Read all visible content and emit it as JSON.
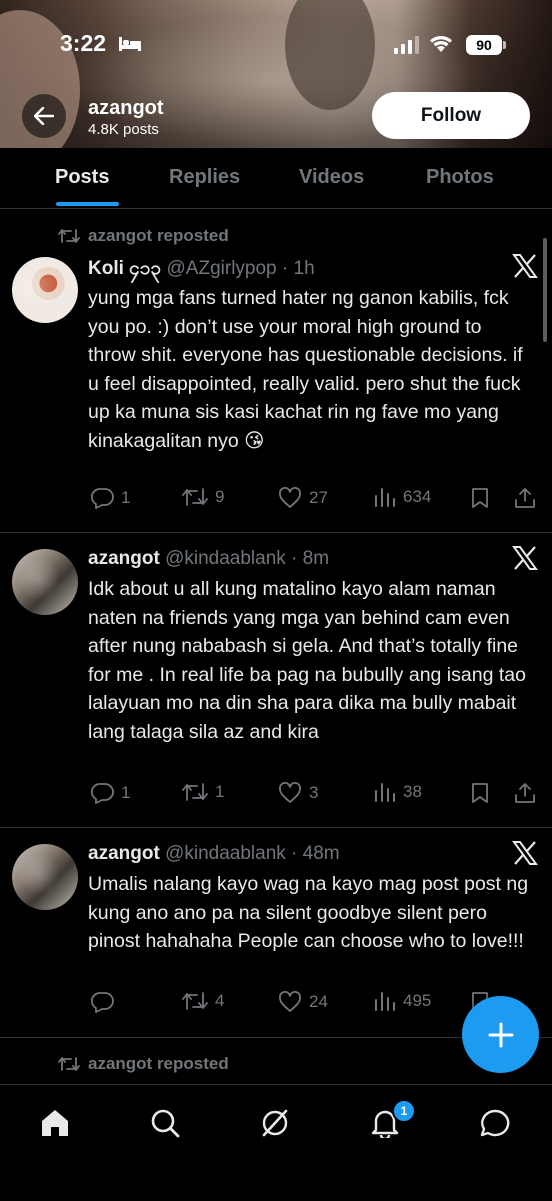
{
  "status_bar": {
    "time": "3:22",
    "battery": "90"
  },
  "profile": {
    "name": "azangot",
    "posts_count": "4.8K posts",
    "follow_label": "Follow"
  },
  "tabs": [
    {
      "label": "Posts"
    },
    {
      "label": "Replies"
    },
    {
      "label": "Videos"
    },
    {
      "label": "Photos"
    }
  ],
  "posts": [
    {
      "repost_label": "azangot reposted",
      "name": "Koli ၄၁၃",
      "handle": "@AZgirlypop",
      "time": "· 1h",
      "text": "yung mga fans turned hater ng ganon kabilis, fck you po. :) don’t use your moral high ground to throw shit. everyone has questionable decisions. if u feel disappointed, really valid. pero shut the fuck up ka muna sis kasi kachat rin ng fave mo yang kinakagalitan nyo 😘",
      "replies": "1",
      "reposts": "9",
      "likes": "27",
      "views": "634"
    },
    {
      "name": "azangot",
      "handle": "@kindaablank",
      "time": "· 8m",
      "text": "Idk about u all kung matalino kayo alam naman naten na friends yang mga yan behind cam even after nung nababash si gela. And that’s totally fine for me . In real life ba pag na bubully ang isang tao lalayuan mo na din sha para dika ma bully mabait lang talaga sila az and kira",
      "replies": "1",
      "reposts": "1",
      "likes": "3",
      "views": "38"
    },
    {
      "name": "azangot",
      "handle": "@kindaablank",
      "time": "· 48m",
      "text": "Umalis nalang kayo wag na kayo mag post post ng kung ano ano pa na silent goodbye silent pero pinost hahahaha People can choose who to love!!!",
      "replies": "",
      "reposts": "4",
      "likes": "24",
      "views": "495"
    },
    {
      "repost_label": "azangot reposted"
    }
  ],
  "nav": {
    "notifications_badge": "1"
  },
  "colors": {
    "accent": "#1d9bf0",
    "background": "#000000",
    "muted": "#71767b",
    "text": "#e7e9ea"
  }
}
